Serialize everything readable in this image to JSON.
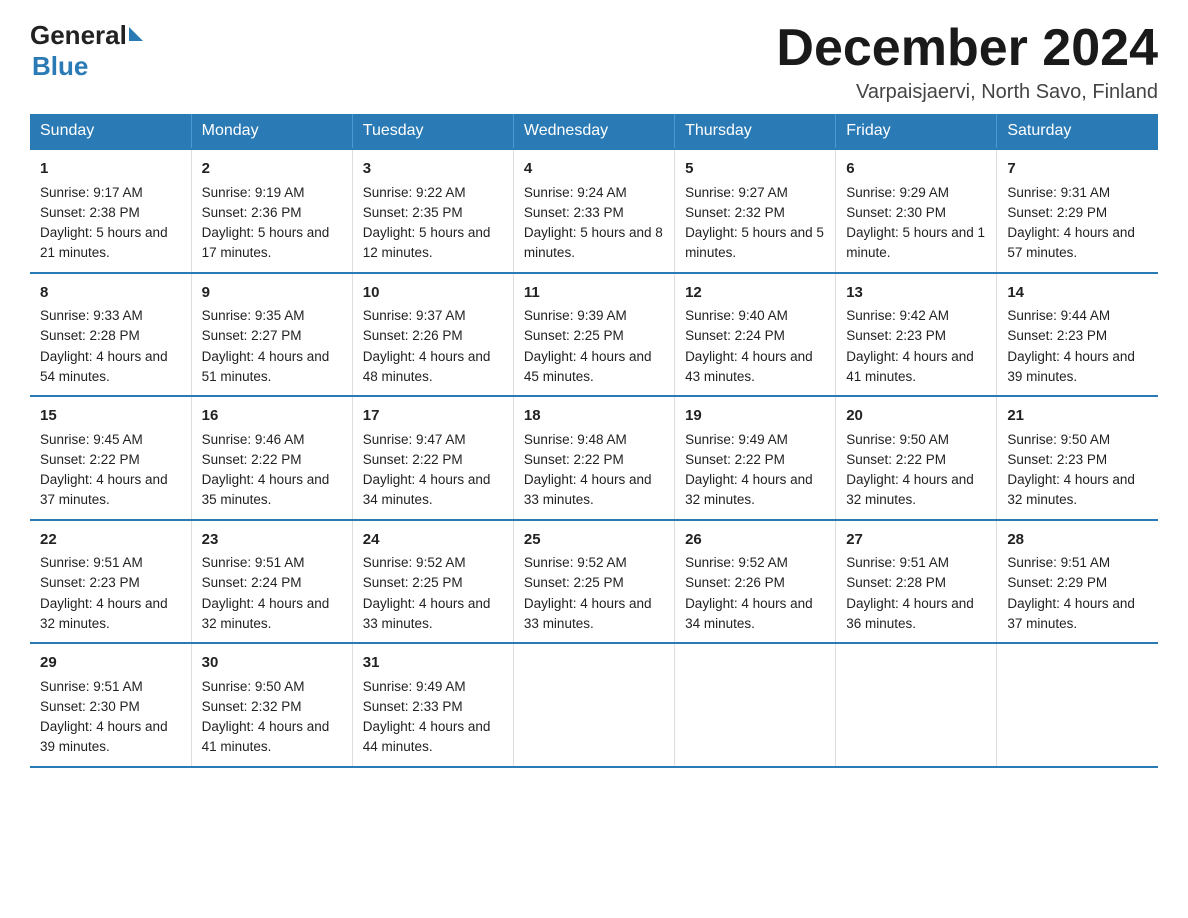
{
  "header": {
    "logo_general": "General",
    "logo_blue": "Blue",
    "month_title": "December 2024",
    "location": "Varpaisjaervi, North Savo, Finland"
  },
  "weekdays": [
    "Sunday",
    "Monday",
    "Tuesday",
    "Wednesday",
    "Thursday",
    "Friday",
    "Saturday"
  ],
  "weeks": [
    [
      {
        "day": "1",
        "sunrise": "9:17 AM",
        "sunset": "2:38 PM",
        "daylight": "5 hours and 21 minutes."
      },
      {
        "day": "2",
        "sunrise": "9:19 AM",
        "sunset": "2:36 PM",
        "daylight": "5 hours and 17 minutes."
      },
      {
        "day": "3",
        "sunrise": "9:22 AM",
        "sunset": "2:35 PM",
        "daylight": "5 hours and 12 minutes."
      },
      {
        "day": "4",
        "sunrise": "9:24 AM",
        "sunset": "2:33 PM",
        "daylight": "5 hours and 8 minutes."
      },
      {
        "day": "5",
        "sunrise": "9:27 AM",
        "sunset": "2:32 PM",
        "daylight": "5 hours and 5 minutes."
      },
      {
        "day": "6",
        "sunrise": "9:29 AM",
        "sunset": "2:30 PM",
        "daylight": "5 hours and 1 minute."
      },
      {
        "day": "7",
        "sunrise": "9:31 AM",
        "sunset": "2:29 PM",
        "daylight": "4 hours and 57 minutes."
      }
    ],
    [
      {
        "day": "8",
        "sunrise": "9:33 AM",
        "sunset": "2:28 PM",
        "daylight": "4 hours and 54 minutes."
      },
      {
        "day": "9",
        "sunrise": "9:35 AM",
        "sunset": "2:27 PM",
        "daylight": "4 hours and 51 minutes."
      },
      {
        "day": "10",
        "sunrise": "9:37 AM",
        "sunset": "2:26 PM",
        "daylight": "4 hours and 48 minutes."
      },
      {
        "day": "11",
        "sunrise": "9:39 AM",
        "sunset": "2:25 PM",
        "daylight": "4 hours and 45 minutes."
      },
      {
        "day": "12",
        "sunrise": "9:40 AM",
        "sunset": "2:24 PM",
        "daylight": "4 hours and 43 minutes."
      },
      {
        "day": "13",
        "sunrise": "9:42 AM",
        "sunset": "2:23 PM",
        "daylight": "4 hours and 41 minutes."
      },
      {
        "day": "14",
        "sunrise": "9:44 AM",
        "sunset": "2:23 PM",
        "daylight": "4 hours and 39 minutes."
      }
    ],
    [
      {
        "day": "15",
        "sunrise": "9:45 AM",
        "sunset": "2:22 PM",
        "daylight": "4 hours and 37 minutes."
      },
      {
        "day": "16",
        "sunrise": "9:46 AM",
        "sunset": "2:22 PM",
        "daylight": "4 hours and 35 minutes."
      },
      {
        "day": "17",
        "sunrise": "9:47 AM",
        "sunset": "2:22 PM",
        "daylight": "4 hours and 34 minutes."
      },
      {
        "day": "18",
        "sunrise": "9:48 AM",
        "sunset": "2:22 PM",
        "daylight": "4 hours and 33 minutes."
      },
      {
        "day": "19",
        "sunrise": "9:49 AM",
        "sunset": "2:22 PM",
        "daylight": "4 hours and 32 minutes."
      },
      {
        "day": "20",
        "sunrise": "9:50 AM",
        "sunset": "2:22 PM",
        "daylight": "4 hours and 32 minutes."
      },
      {
        "day": "21",
        "sunrise": "9:50 AM",
        "sunset": "2:23 PM",
        "daylight": "4 hours and 32 minutes."
      }
    ],
    [
      {
        "day": "22",
        "sunrise": "9:51 AM",
        "sunset": "2:23 PM",
        "daylight": "4 hours and 32 minutes."
      },
      {
        "day": "23",
        "sunrise": "9:51 AM",
        "sunset": "2:24 PM",
        "daylight": "4 hours and 32 minutes."
      },
      {
        "day": "24",
        "sunrise": "9:52 AM",
        "sunset": "2:25 PM",
        "daylight": "4 hours and 33 minutes."
      },
      {
        "day": "25",
        "sunrise": "9:52 AM",
        "sunset": "2:25 PM",
        "daylight": "4 hours and 33 minutes."
      },
      {
        "day": "26",
        "sunrise": "9:52 AM",
        "sunset": "2:26 PM",
        "daylight": "4 hours and 34 minutes."
      },
      {
        "day": "27",
        "sunrise": "9:51 AM",
        "sunset": "2:28 PM",
        "daylight": "4 hours and 36 minutes."
      },
      {
        "day": "28",
        "sunrise": "9:51 AM",
        "sunset": "2:29 PM",
        "daylight": "4 hours and 37 minutes."
      }
    ],
    [
      {
        "day": "29",
        "sunrise": "9:51 AM",
        "sunset": "2:30 PM",
        "daylight": "4 hours and 39 minutes."
      },
      {
        "day": "30",
        "sunrise": "9:50 AM",
        "sunset": "2:32 PM",
        "daylight": "4 hours and 41 minutes."
      },
      {
        "day": "31",
        "sunrise": "9:49 AM",
        "sunset": "2:33 PM",
        "daylight": "4 hours and 44 minutes."
      },
      null,
      null,
      null,
      null
    ]
  ]
}
